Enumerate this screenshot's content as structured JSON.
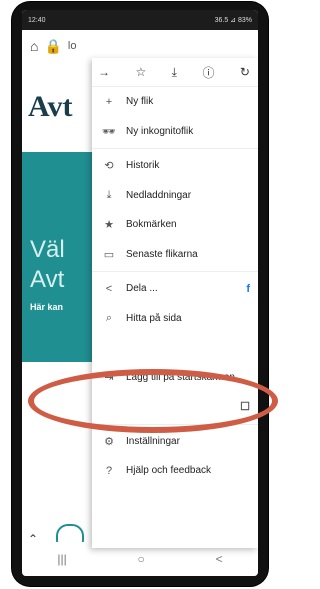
{
  "status": {
    "time": "12:40",
    "right": "36.5 ⊿ 83%"
  },
  "browser": {
    "url_prefix": "lo"
  },
  "page": {
    "logo": "Avt",
    "hero_line1": "Väl",
    "hero_line2": "Avt",
    "hero_sub": "Här kan"
  },
  "menu": {
    "top_icons": [
      "arrow-forward",
      "star",
      "download",
      "info",
      "refresh"
    ],
    "items": [
      {
        "label": "Ny flik",
        "icon": "+"
      },
      {
        "label": "Ny inkognitoflik",
        "icon": "🕶"
      },
      {
        "label": "Historik",
        "icon": "⟲"
      },
      {
        "label": "Nedladdningar",
        "icon": "⤓"
      },
      {
        "label": "Bokmärken",
        "icon": "★"
      },
      {
        "label": "Senaste flikarna",
        "icon": "▭"
      },
      {
        "label": "Dela ...",
        "icon": "<",
        "right": "f"
      },
      {
        "label": "Hitta på sida",
        "icon": "⌕"
      },
      {
        "label": "",
        "icon": ""
      },
      {
        "label": "Lägg till på startskärmen",
        "icon": "⇥"
      },
      {
        "label": "",
        "icon": ""
      },
      {
        "label": "Inställningar",
        "icon": "⚙"
      },
      {
        "label": "Hjälp och feedback",
        "icon": "?"
      }
    ]
  },
  "nav": {
    "left": "|||",
    "center": "○",
    "right": "<"
  }
}
